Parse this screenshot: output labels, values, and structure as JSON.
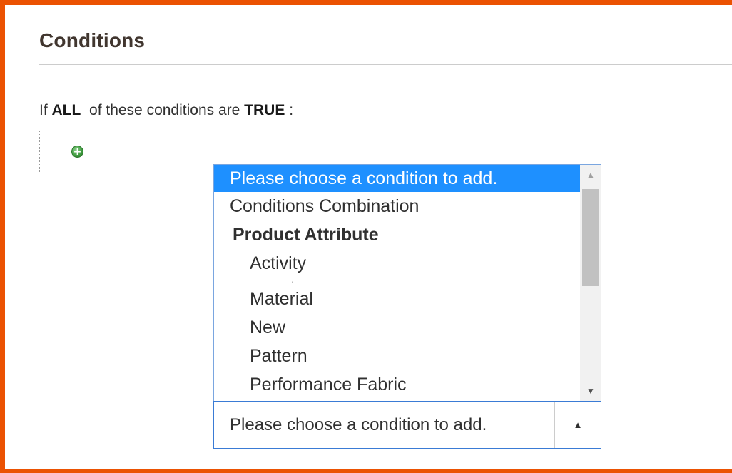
{
  "section": {
    "title": "Conditions"
  },
  "rule": {
    "prefix": "If",
    "aggregator": "ALL",
    "middle": "of these conditions are",
    "value": "TRUE",
    "suffix": ":"
  },
  "add_button": {
    "icon": "plus-circle-icon",
    "color": "#3e9a3e"
  },
  "listbox": {
    "options": [
      {
        "label": "Please choose a condition to add.",
        "type": "option",
        "selected": true
      },
      {
        "label": "Conditions Combination",
        "type": "option"
      },
      {
        "label": "Product Attribute",
        "type": "group"
      },
      {
        "label": "Activity",
        "type": "option-indent"
      },
      {
        "label": "Material",
        "type": "option-indent"
      },
      {
        "label": "New",
        "type": "option-indent"
      },
      {
        "label": "Pattern",
        "type": "option-indent"
      },
      {
        "label": "Performance Fabric",
        "type": "option-indent"
      }
    ],
    "selected_color": "#1e90ff"
  },
  "select": {
    "value": "Please choose a condition to add.",
    "arrow_icon": "triangle-up-icon"
  },
  "colors": {
    "frame_accent": "#eb5202"
  }
}
